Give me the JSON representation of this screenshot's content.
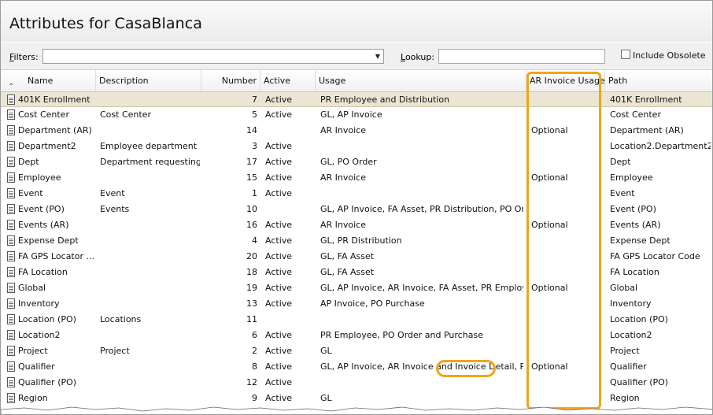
{
  "window": {
    "title": "Attributes for CasaBlanca"
  },
  "filters": {
    "filters_label_prefix": "F",
    "filters_label_rest": "ilters:",
    "filters_value": "",
    "lookup_label_prefix": "L",
    "lookup_label_rest": "ookup:",
    "lookup_value": "",
    "include_obsolete_label": "Include Obsolete",
    "include_obsolete_checked": false
  },
  "columns": {
    "name": "Name",
    "description": "Description",
    "number": "Number",
    "active": "Active",
    "usage": "Usage",
    "ar_invoice_usage": "AR Invoice Usage",
    "path": "Path"
  },
  "rows": [
    {
      "name": "401K Enrollment",
      "description": "",
      "number": "7",
      "active": "Active",
      "usage": "PR Employee and Distribution",
      "ar": "",
      "path": "401K Enrollment"
    },
    {
      "name": "Cost Center",
      "description": "Cost Center",
      "number": "5",
      "active": "Active",
      "usage": "GL, AP Invoice",
      "ar": "",
      "path": "Cost Center"
    },
    {
      "name": "Department (AR)",
      "description": "",
      "number": "14",
      "active": "",
      "usage": "AR Invoice",
      "ar": "Optional",
      "path": "Department (AR)"
    },
    {
      "name": "Department2",
      "description": "Employee department",
      "number": "3",
      "active": "Active",
      "usage": "",
      "ar": "",
      "path": "Location2.Department2"
    },
    {
      "name": "Dept",
      "description": "Department requesting...",
      "number": "17",
      "active": "Active",
      "usage": "GL, PO Order",
      "ar": "",
      "path": "Dept"
    },
    {
      "name": "Employee",
      "description": "",
      "number": "15",
      "active": "Active",
      "usage": "AR Invoice",
      "ar": "Optional",
      "path": "Employee"
    },
    {
      "name": "Event",
      "description": "Event",
      "number": "1",
      "active": "Active",
      "usage": "",
      "ar": "",
      "path": "Event"
    },
    {
      "name": "Event (PO)",
      "description": "Events",
      "number": "10",
      "active": "",
      "usage": "GL, AP Invoice, FA Asset, PR Distribution, PO Orde...",
      "ar": "",
      "path": "Event (PO)"
    },
    {
      "name": "Events (AR)",
      "description": "",
      "number": "16",
      "active": "Active",
      "usage": "AR Invoice",
      "ar": "Optional",
      "path": "Events (AR)"
    },
    {
      "name": "Expense Dept",
      "description": "",
      "number": "4",
      "active": "Active",
      "usage": "GL, PR Distribution",
      "ar": "",
      "path": "Expense Dept"
    },
    {
      "name": "FA GPS Locator ...",
      "description": "",
      "number": "20",
      "active": "Active",
      "usage": "GL, FA Asset",
      "ar": "",
      "path": "FA GPS Locator Code"
    },
    {
      "name": "FA Location",
      "description": "",
      "number": "18",
      "active": "Active",
      "usage": "GL, FA Asset",
      "ar": "",
      "path": "FA Location"
    },
    {
      "name": "Global",
      "description": "",
      "number": "19",
      "active": "Active",
      "usage": "GL, AP Invoice, AR Invoice, FA Asset, PR Employe...",
      "ar": "Optional",
      "path": "Global"
    },
    {
      "name": "Inventory",
      "description": "",
      "number": "13",
      "active": "Active",
      "usage": "AP Invoice, PO Purchase",
      "ar": "",
      "path": "Inventory"
    },
    {
      "name": "Location (PO)",
      "description": "Locations",
      "number": "11",
      "active": "",
      "usage": "",
      "ar": "",
      "path": "Location (PO)"
    },
    {
      "name": "Location2",
      "description": "",
      "number": "6",
      "active": "Active",
      "usage": "PR Employee, PO Order and Purchase",
      "ar": "",
      "path": "Location2"
    },
    {
      "name": "Project",
      "description": "Project",
      "number": "2",
      "active": "Active",
      "usage": "GL",
      "ar": "",
      "path": "Project"
    },
    {
      "name": "Qualifier",
      "description": "",
      "number": "8",
      "active": "Active",
      "usage": "GL, AP Invoice, AR Invoice and Invoice Detail, PR ...",
      "ar": "Optional",
      "path": "Qualifier"
    },
    {
      "name": "Qualifier (PO)",
      "description": "",
      "number": "12",
      "active": "Active",
      "usage": "",
      "ar": "",
      "path": "Qualifier (PO)"
    },
    {
      "name": "Region",
      "description": "",
      "number": "9",
      "active": "Active",
      "usage": "GL",
      "ar": "",
      "path": "Region"
    }
  ],
  "colors": {
    "highlight": "#f2a516",
    "selected_row": "#ebe6d3"
  },
  "icons": {
    "sort": "chevron-up-icon",
    "row": "document-icon",
    "dropdown": "chevron-down-icon"
  }
}
